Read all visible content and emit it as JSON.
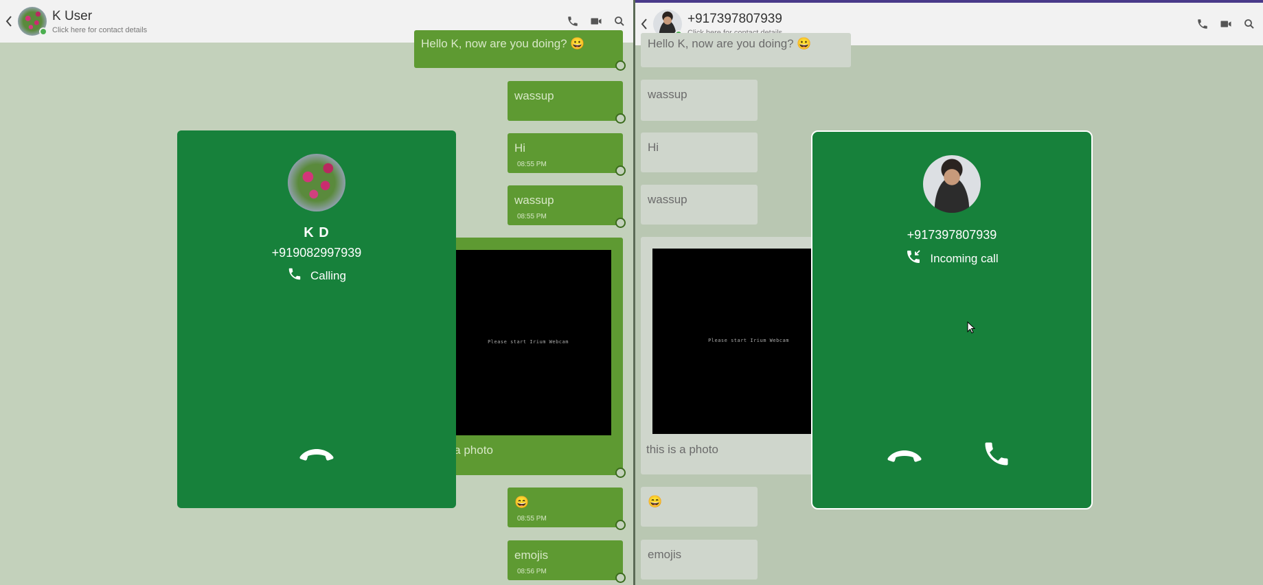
{
  "left": {
    "header": {
      "name": "K User",
      "subtitle": "Click here for contact details"
    },
    "messages": [
      {
        "text": "Hello K, now are you doing? 😀",
        "time": ""
      },
      {
        "text": "wassup",
        "time": ""
      },
      {
        "text": "Hi",
        "time": "08:55 PM"
      },
      {
        "text": "wassup",
        "time": "08:55 PM"
      },
      {
        "text": "this is a photo",
        "time": ""
      },
      {
        "text": "😄",
        "time": "08:55 PM"
      },
      {
        "text": "emojis",
        "time": "08:56 PM"
      }
    ],
    "photo_text": "Please start Irium Webcam",
    "call": {
      "name": "K D",
      "number": "+919082997939",
      "status": "Calling"
    }
  },
  "right": {
    "header": {
      "name": "+917397807939",
      "subtitle": "Click here for contact details"
    },
    "messages": [
      {
        "text": "Hello K, now are you doing? 😀"
      },
      {
        "text": "wassup"
      },
      {
        "text": "Hi"
      },
      {
        "text": "wassup"
      },
      {
        "text": "this is a photo"
      },
      {
        "text": "😄"
      },
      {
        "text": "emojis"
      }
    ],
    "photo_text": "Please start Irium Webcam",
    "call": {
      "number": "+917397807939",
      "status": "Incoming call"
    }
  },
  "icons": {
    "back": "chevron-left-icon",
    "voice_call": "phone-icon",
    "video_call": "video-icon",
    "search": "search-icon",
    "hangup": "hangup-icon",
    "answer": "phone-answer-icon",
    "incoming": "incoming-call-icon"
  },
  "colors": {
    "call_card": "#17813b",
    "outgoing_bubble": "#5e9a32",
    "online": "#4caf50"
  }
}
